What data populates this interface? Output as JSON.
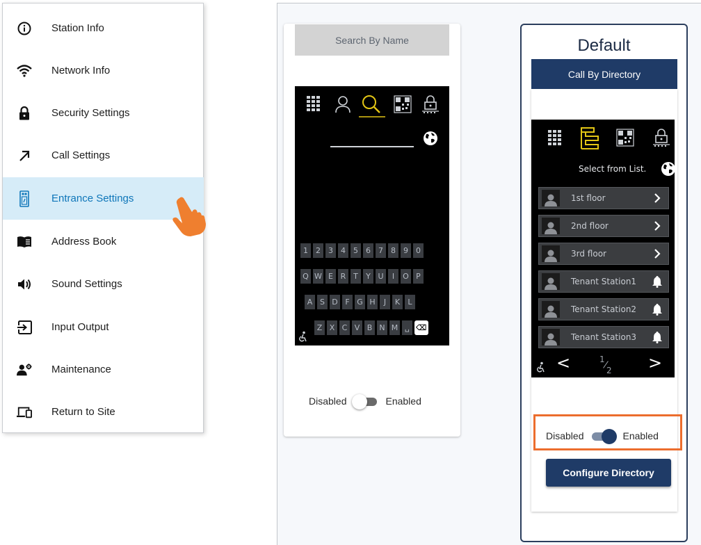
{
  "sidebar": {
    "items": [
      {
        "label": "Station Info",
        "icon": "info-icon"
      },
      {
        "label": "Network Info",
        "icon": "wifi-icon"
      },
      {
        "label": "Security Settings",
        "icon": "lock-icon"
      },
      {
        "label": "Call Settings",
        "icon": "arrow-up-right-icon"
      },
      {
        "label": "Entrance Settings",
        "icon": "entrance-panel-icon",
        "active": true
      },
      {
        "label": "Address Book",
        "icon": "book-icon"
      },
      {
        "label": "Sound Settings",
        "icon": "speaker-icon"
      },
      {
        "label": "Input Output",
        "icon": "input-output-icon"
      },
      {
        "label": "Maintenance",
        "icon": "maintenance-icon"
      },
      {
        "label": "Return to Site",
        "icon": "devices-icon"
      }
    ]
  },
  "left_card": {
    "header": "Search By Name",
    "keyboard": {
      "row1": [
        "1",
        "2",
        "3",
        "4",
        "5",
        "6",
        "7",
        "8",
        "9",
        "0"
      ],
      "row2": [
        "Q",
        "W",
        "E",
        "R",
        "T",
        "Y",
        "U",
        "I",
        "O",
        "P"
      ],
      "row3": [
        "A",
        "S",
        "D",
        "F",
        "G",
        "H",
        "J",
        "K",
        "L"
      ],
      "row4": [
        "Z",
        "X",
        "C",
        "V",
        "B",
        "N",
        "M",
        "␣",
        "⌫"
      ]
    },
    "toggle": {
      "off_label": "Disabled",
      "on_label": "Enabled",
      "enabled": false
    }
  },
  "right_card": {
    "title": "Default",
    "header": "Call By Directory",
    "prompt": "Select from List.",
    "entries": [
      {
        "label": "1st floor",
        "end": "chevron"
      },
      {
        "label": "2nd floor",
        "end": "chevron"
      },
      {
        "label": "3rd floor",
        "end": "chevron"
      },
      {
        "label": "Tenant Station1",
        "end": "bell"
      },
      {
        "label": "Tenant Station2",
        "end": "bell"
      },
      {
        "label": "Tenant Station3",
        "end": "bell"
      }
    ],
    "pager": {
      "prev": "<",
      "numerator": "1",
      "denominator": "2",
      "next": ">"
    },
    "toggle": {
      "off_label": "Disabled",
      "on_label": "Enabled",
      "enabled": true
    },
    "button": "Configure Directory"
  },
  "colors": {
    "active_bg": "#d6ecf8",
    "active_text": "#0e76b9",
    "navy": "#1f3b67",
    "highlight": "#ec6d2d",
    "accent_yellow": "#e3c615",
    "hand": "#ef7f2f"
  }
}
